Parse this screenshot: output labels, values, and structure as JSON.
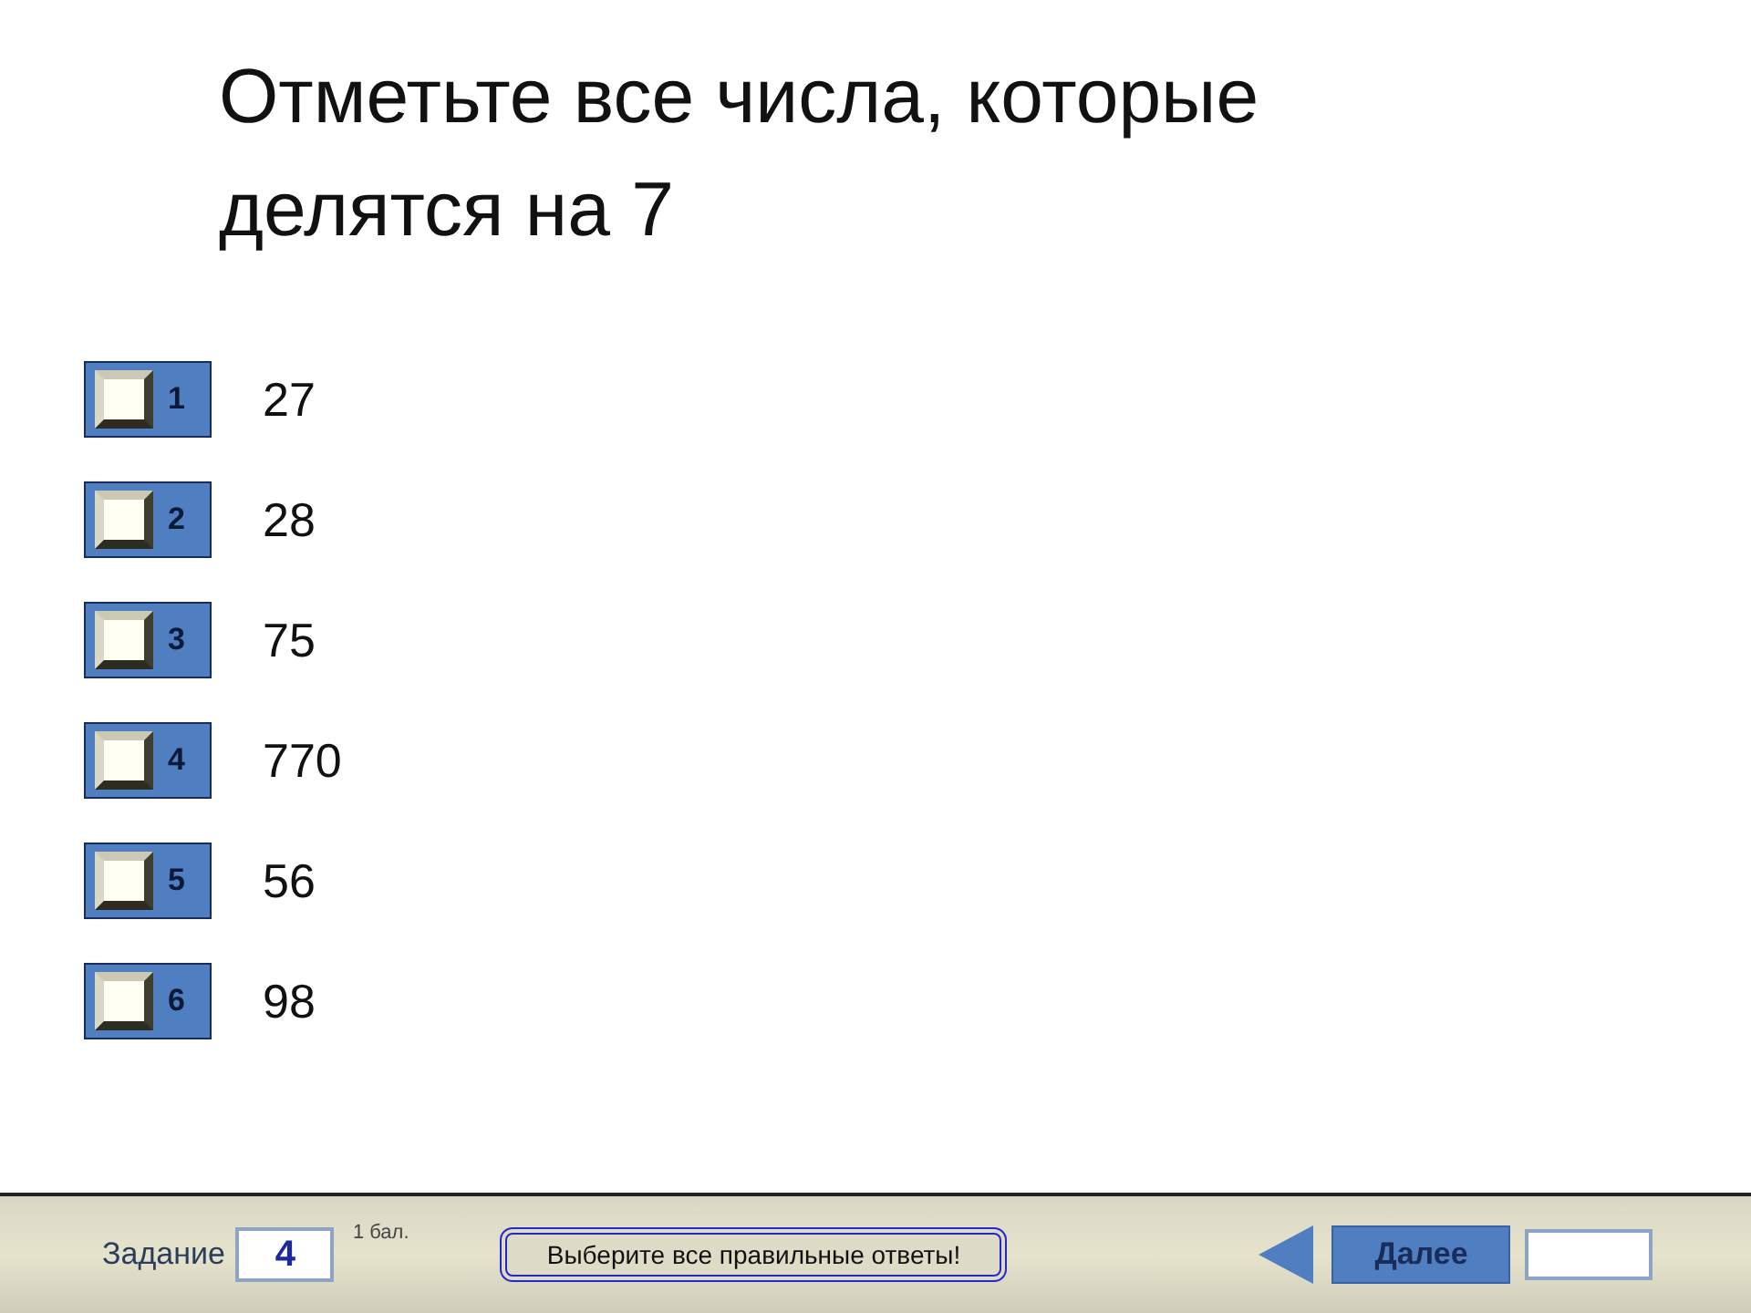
{
  "question": "Отметьте все числа, которые делятся на 7",
  "options": [
    {
      "number": "1",
      "label": "27",
      "checked": false
    },
    {
      "number": "2",
      "label": "28",
      "checked": false
    },
    {
      "number": "3",
      "label": "75",
      "checked": false
    },
    {
      "number": "4",
      "label": "770",
      "checked": false
    },
    {
      "number": "5",
      "label": "56",
      "checked": false
    },
    {
      "number": "6",
      "label": "98",
      "checked": false
    }
  ],
  "footer": {
    "task_label": "Задание",
    "task_number": "4",
    "points": "1 бал.",
    "hint_button": "Выберите все правильные ответы!",
    "next_button": "Далее"
  }
}
